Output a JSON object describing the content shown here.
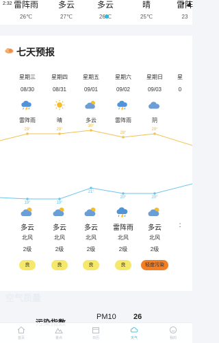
{
  "status": {
    "time": "2:32",
    "right_glyphs": "▾ ◢"
  },
  "hourly": [
    {
      "cond": "雷阵雨",
      "temp": "26℃"
    },
    {
      "cond": "多云",
      "temp": "27℃"
    },
    {
      "cond": "多云",
      "temp": "26℃"
    },
    {
      "cond": "晴",
      "temp": "25℃"
    },
    {
      "cond": "雷阵",
      "temp": "23"
    }
  ],
  "forecast": {
    "title": "七天预报",
    "days": [
      {
        "name": "星期三",
        "date": "08/30",
        "day_cond": "雷阵雨",
        "day_icon": "thunder-icon",
        "high": "29°",
        "low": "19°",
        "night_cond": "多云",
        "night_icon": "cloud-sun-icon",
        "wind_dir": "北风",
        "wind_level": "2级",
        "aqi": "良"
      },
      {
        "name": "星期四",
        "date": "08/31",
        "day_cond": "晴",
        "day_icon": "sun-icon",
        "high": "29°",
        "low": "19°",
        "night_cond": "多云",
        "night_icon": "cloud-sun-icon",
        "wind_dir": "北风",
        "wind_level": "2级",
        "aqi": "良"
      },
      {
        "name": "星期五",
        "date": "09/01",
        "day_cond": "多云",
        "day_icon": "cloud-sun-icon",
        "high": "30°",
        "low": "21°",
        "night_cond": "多云",
        "night_icon": "cloud-sun-icon",
        "wind_dir": "北风",
        "wind_level": "2级",
        "aqi": "良"
      },
      {
        "name": "星期六",
        "date": "09/02",
        "day_cond": "雷阵雨",
        "day_icon": "thunder-icon",
        "high": "28°",
        "low": "20°",
        "night_cond": "雷阵雨",
        "night_icon": "thunder-icon",
        "wind_dir": "北风",
        "wind_level": "2级",
        "aqi": "良"
      },
      {
        "name": "星期日",
        "date": "09/03",
        "day_cond": "阴",
        "day_icon": "overcast-icon",
        "high": "29°",
        "low": "20°",
        "night_cond": "多云",
        "night_icon": "cloud-sun-icon",
        "wind_dir": "北风",
        "wind_level": "2级",
        "aqi": "轻度污染"
      },
      {
        "name": "星",
        "date": "0",
        "day_cond": "",
        "day_icon": "",
        "high": "",
        "low": "",
        "night_cond": ":",
        "night_icon": "",
        "wind_dir": "",
        "wind_level": "",
        "aqi": ""
      }
    ]
  },
  "air": {
    "title": "空气质量",
    "pollution_label": "污染指数",
    "pm_label": "PM10",
    "pm_value": "26"
  },
  "nav": [
    {
      "label": "首页",
      "icon": "home-icon",
      "active": false
    },
    {
      "label": "景点",
      "icon": "mountain-icon",
      "active": false
    },
    {
      "label": "日历",
      "icon": "calendar-icon",
      "active": false
    },
    {
      "label": "天气",
      "icon": "weather-icon",
      "active": true
    },
    {
      "label": "我的",
      "icon": "smile-icon",
      "active": false
    }
  ],
  "colors": {
    "high_line": "#f2c14e",
    "low_line": "#6cc6ec",
    "aqi_good": "#f5e86a",
    "aqi_light_pollution": "#f47e22",
    "accent": "#48c2e7"
  }
}
